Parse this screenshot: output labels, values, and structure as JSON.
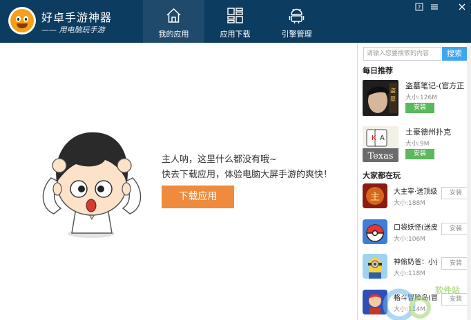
{
  "app": {
    "title": "好卓手游神器",
    "slogan": "—— 用电脑玩手游"
  },
  "nav": {
    "tabs": [
      {
        "label": "我的应用",
        "icon": "home-icon",
        "active": true
      },
      {
        "label": "应用下载",
        "icon": "grid-icon",
        "active": false
      },
      {
        "label": "引擎管理",
        "icon": "android-icon",
        "active": false
      }
    ]
  },
  "window_controls": [
    "help-icon",
    "menu-icon",
    "close-icon"
  ],
  "main": {
    "empty_line1": "主人呐，这里什么都没有哦~",
    "empty_line2": "快去下载应用，体验电脑大屏手游的爽快！",
    "download_button": "下载应用"
  },
  "sidebar": {
    "search_placeholder": "请输入您要搜索的内容",
    "search_button": "搜索",
    "daily_title": "每日推荐",
    "daily": [
      {
        "name": "盗墓笔记-(官方正",
        "size": "大小:126M",
        "install": "安装",
        "icon": "daomu-game-icon"
      },
      {
        "name": "土豪德州扑克",
        "size": "大小:9M",
        "install": "安装",
        "icon": "texas-poker-icon"
      }
    ],
    "popular_title": "大家都在玩",
    "popular": [
      {
        "name": "大主宰·送顶级红",
        "size": "大小:188M",
        "install": "安装",
        "icon": "dazhuzai-game-icon"
      },
      {
        "name": "口袋妖怪(送皮卡",
        "size": "大小:106M",
        "install": "安装",
        "icon": "pokemon-game-icon"
      },
      {
        "name": "神偷奶爸：小黄",
        "size": "大小:118M",
        "install": "安装",
        "icon": "minion-game-icon"
      },
      {
        "name": "格斗冒险岛(冒险",
        "size": "大小:114M",
        "install": "安装",
        "icon": "fighter-game-icon"
      }
    ]
  },
  "watermark": {
    "text": "软件站"
  },
  "colors": {
    "titlebar": "#0d3c61",
    "active_tab": "#1f4a6c",
    "download_button": "#f08a3c",
    "search_button": "#3ea6ef",
    "install_green": "#5cb85c"
  }
}
